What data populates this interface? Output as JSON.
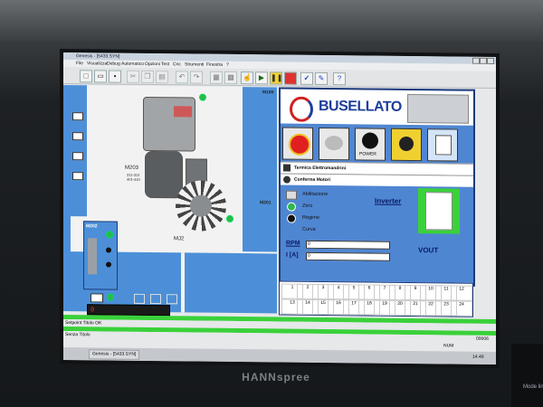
{
  "window": {
    "title": "Genesis - [5433.SYN]"
  },
  "menu": [
    "File",
    "Visualizza",
    "Debug",
    "Automatico",
    "Opzioni",
    "Test",
    "Cnc",
    "Strumenti",
    "Finestra",
    "?"
  ],
  "brand": {
    "logo": "BUSELLATO",
    "monitor": "HANNspree"
  },
  "machines": {
    "m165": "M165",
    "m203": "M203",
    "m203_sub": [
      "311-312",
      "401-410"
    ],
    "mj2": "MJ2",
    "m202": "M202",
    "m201": "M201"
  },
  "control": {
    "power_label": "POWER",
    "termica": "Termica Elettromandrini",
    "conferma": "Conferma Motori",
    "abilitazione": "Abilitazione",
    "zero": "Zero",
    "regime": "Regime",
    "curva": "Curva",
    "inverter": "Inverter",
    "rpm_label": "RPM",
    "rpm_value": "0",
    "current_label": "I [A]",
    "current_value": "0",
    "vout": "VOUT"
  },
  "grid": {
    "row1": [
      "1",
      "2",
      "3",
      "4",
      "5",
      "6",
      "7",
      "8",
      "9",
      "10",
      "11",
      "12"
    ],
    "row2": [
      "13",
      "14",
      "15",
      "16",
      "17",
      "18",
      "19",
      "20",
      "21",
      "22",
      "23",
      "24"
    ]
  },
  "counter": {
    "value": "0"
  },
  "status": {
    "line1": "Setpoint Titolo OK",
    "line2": "Senza Titolo",
    "num": "NUM",
    "right_value": "00006"
  },
  "taskbar": {
    "app": "Genesis - [5433.SYN]",
    "time": "14.40"
  },
  "side_plate": {
    "text": "Mode lin"
  },
  "colors": {
    "panel_blue": "#4f86d2",
    "accent_green": "#3ad13a",
    "logo_blue": "#1e3e9a"
  }
}
